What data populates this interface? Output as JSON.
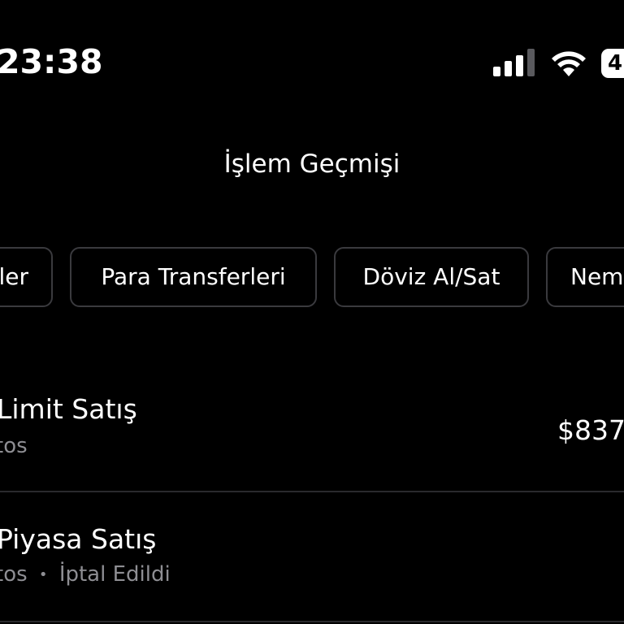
{
  "status_bar": {
    "time": "23:38",
    "battery": "4",
    "signal_icon": "cellular-signal-icon",
    "wifi_icon": "wifi-icon",
    "battery_icon": "battery-icon"
  },
  "header": {
    "title": "İşlem Geçmişi"
  },
  "filters": [
    {
      "label": "ler"
    },
    {
      "label": "Para Transferleri"
    },
    {
      "label": "Döviz Al/Sat"
    },
    {
      "label": "Nem"
    }
  ],
  "transactions": [
    {
      "title": "Limit Satış",
      "subtitle": "tos",
      "amount": "$837"
    },
    {
      "title": "Piyasa Satış",
      "subtitle": "tos",
      "status": "İptal Edildi",
      "separator": "•"
    }
  ]
}
